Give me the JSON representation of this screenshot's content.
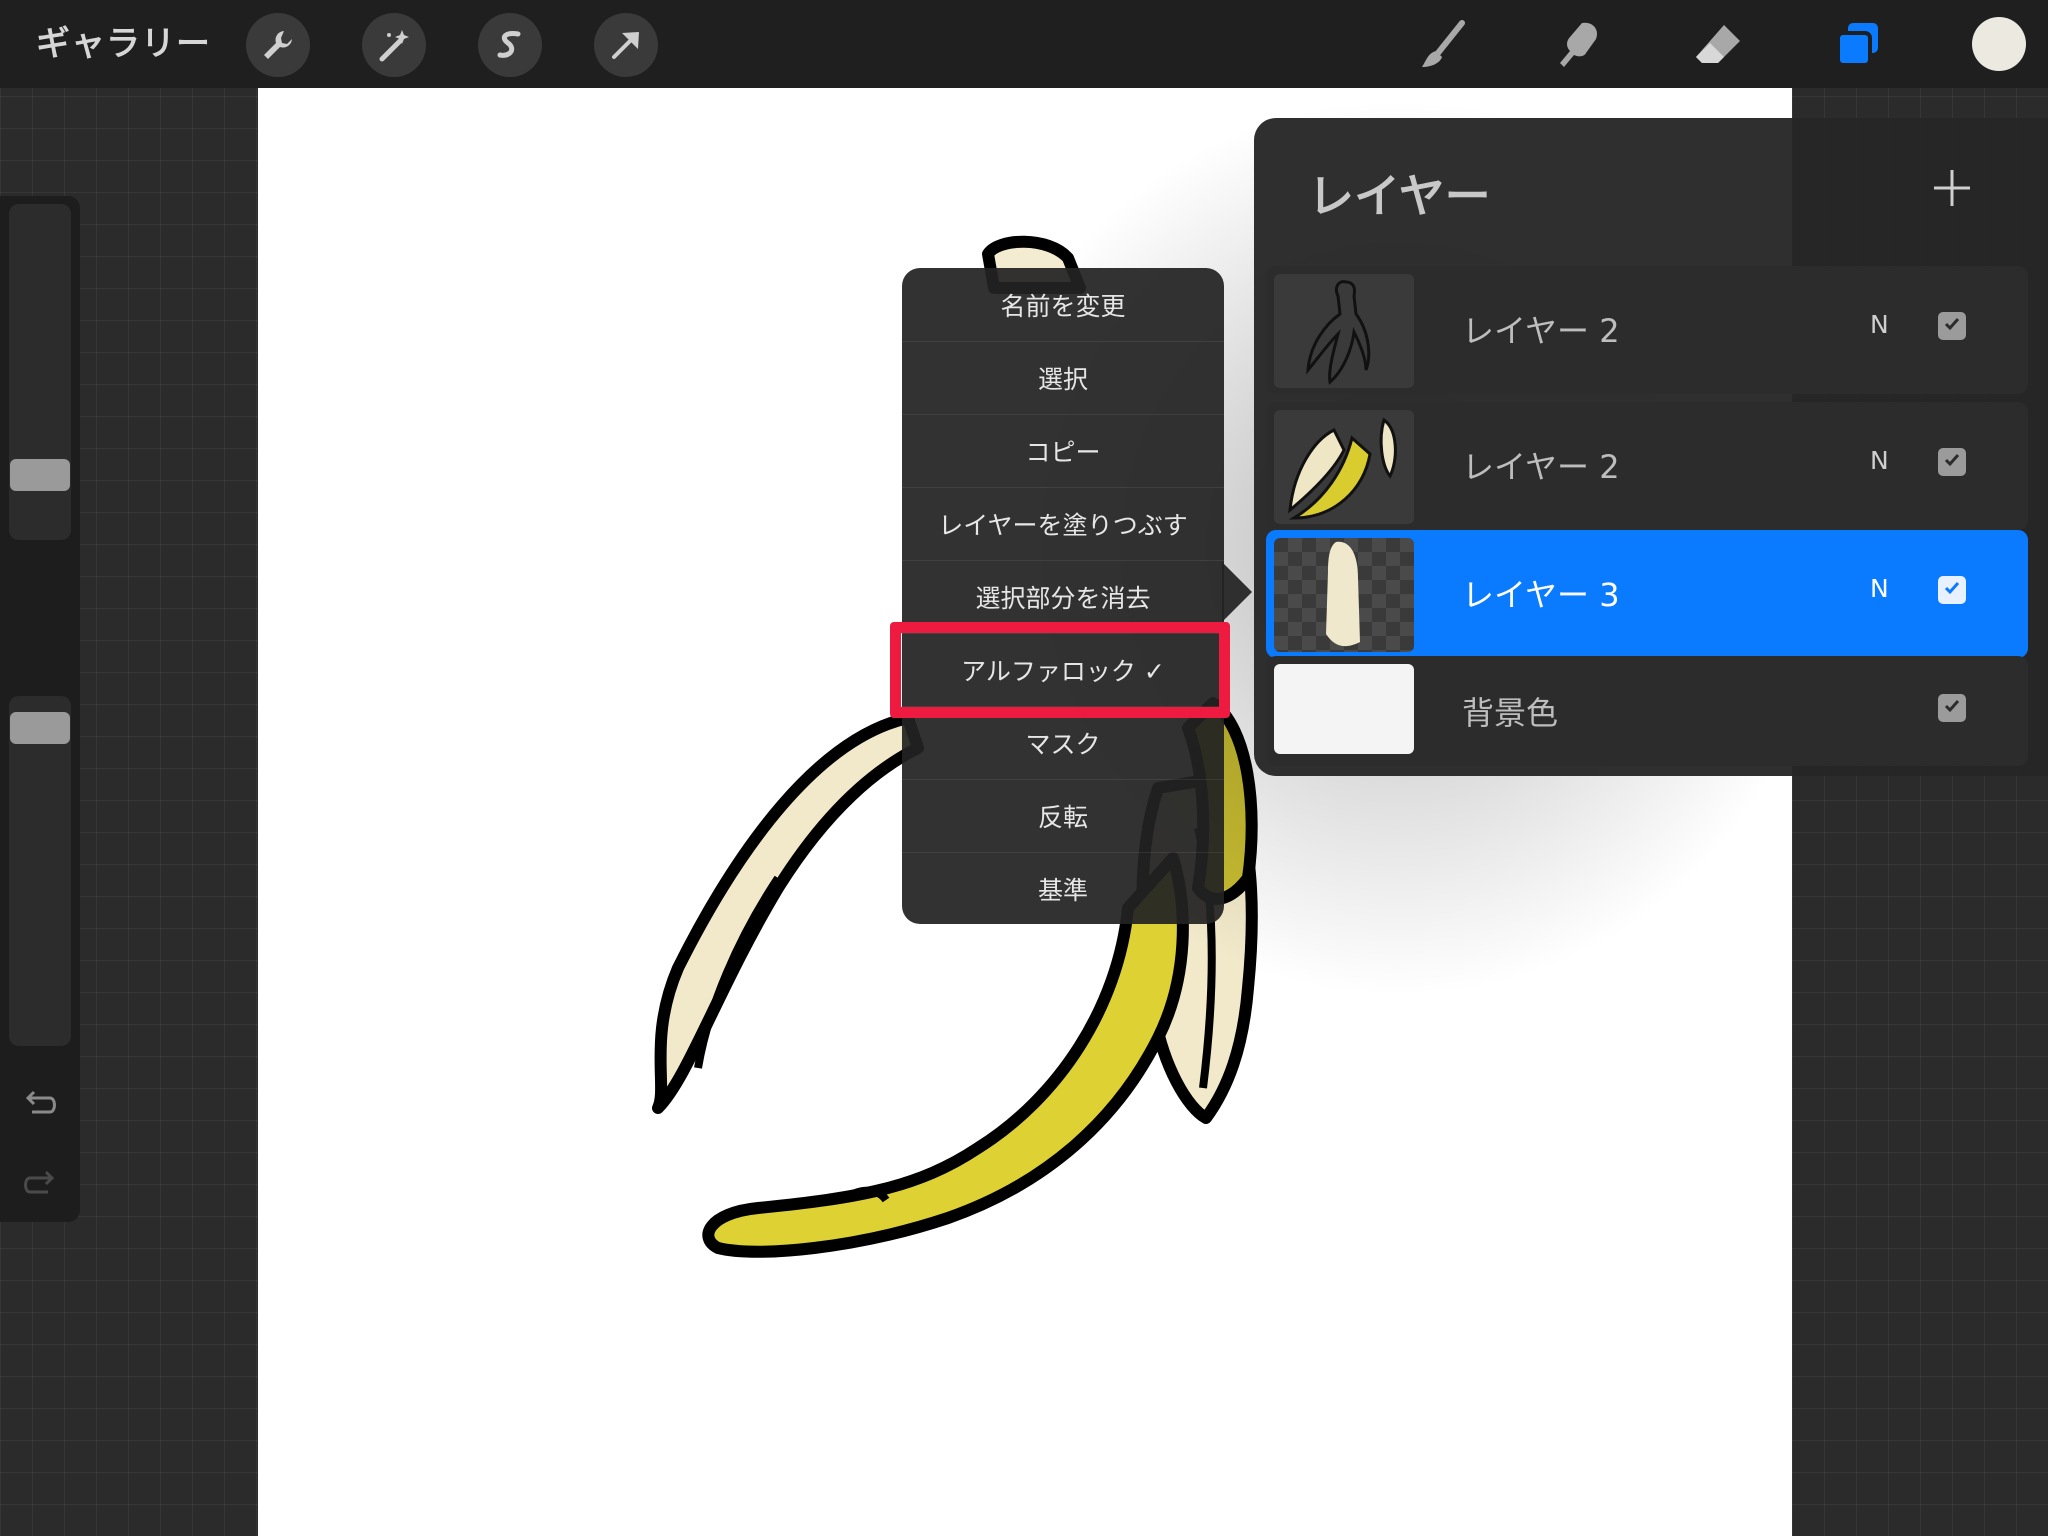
{
  "topbar": {
    "gallery_label": "ギャラリー",
    "left_tools": [
      "wrench-icon",
      "magic-wand-icon",
      "selection-icon",
      "transform-arrow-icon"
    ],
    "right_tools": [
      "brush-icon",
      "smudge-icon",
      "eraser-icon",
      "layers-icon"
    ],
    "color_swatch": "#ece9e1",
    "accent": "#0a7aff"
  },
  "context_menu": {
    "items": [
      "名前を変更",
      "選択",
      "コピー",
      "レイヤーを塗りつぶす",
      "選択部分を消去",
      "アルファロック ✓",
      "マスク",
      "反転",
      "基準"
    ],
    "highlighted_item": "アルファロック ✓",
    "highlight_color": "#ee1a40"
  },
  "layers_panel": {
    "title": "レイヤー",
    "layers": [
      {
        "name": "レイヤー 2",
        "blend": "N",
        "visible": true,
        "active": false
      },
      {
        "name": "レイヤー 2",
        "blend": "N",
        "visible": true,
        "active": false
      },
      {
        "name": "レイヤー 3",
        "blend": "N",
        "visible": true,
        "active": true
      },
      {
        "name": "背景色",
        "blend": "",
        "visible": true,
        "active": false
      }
    ]
  }
}
